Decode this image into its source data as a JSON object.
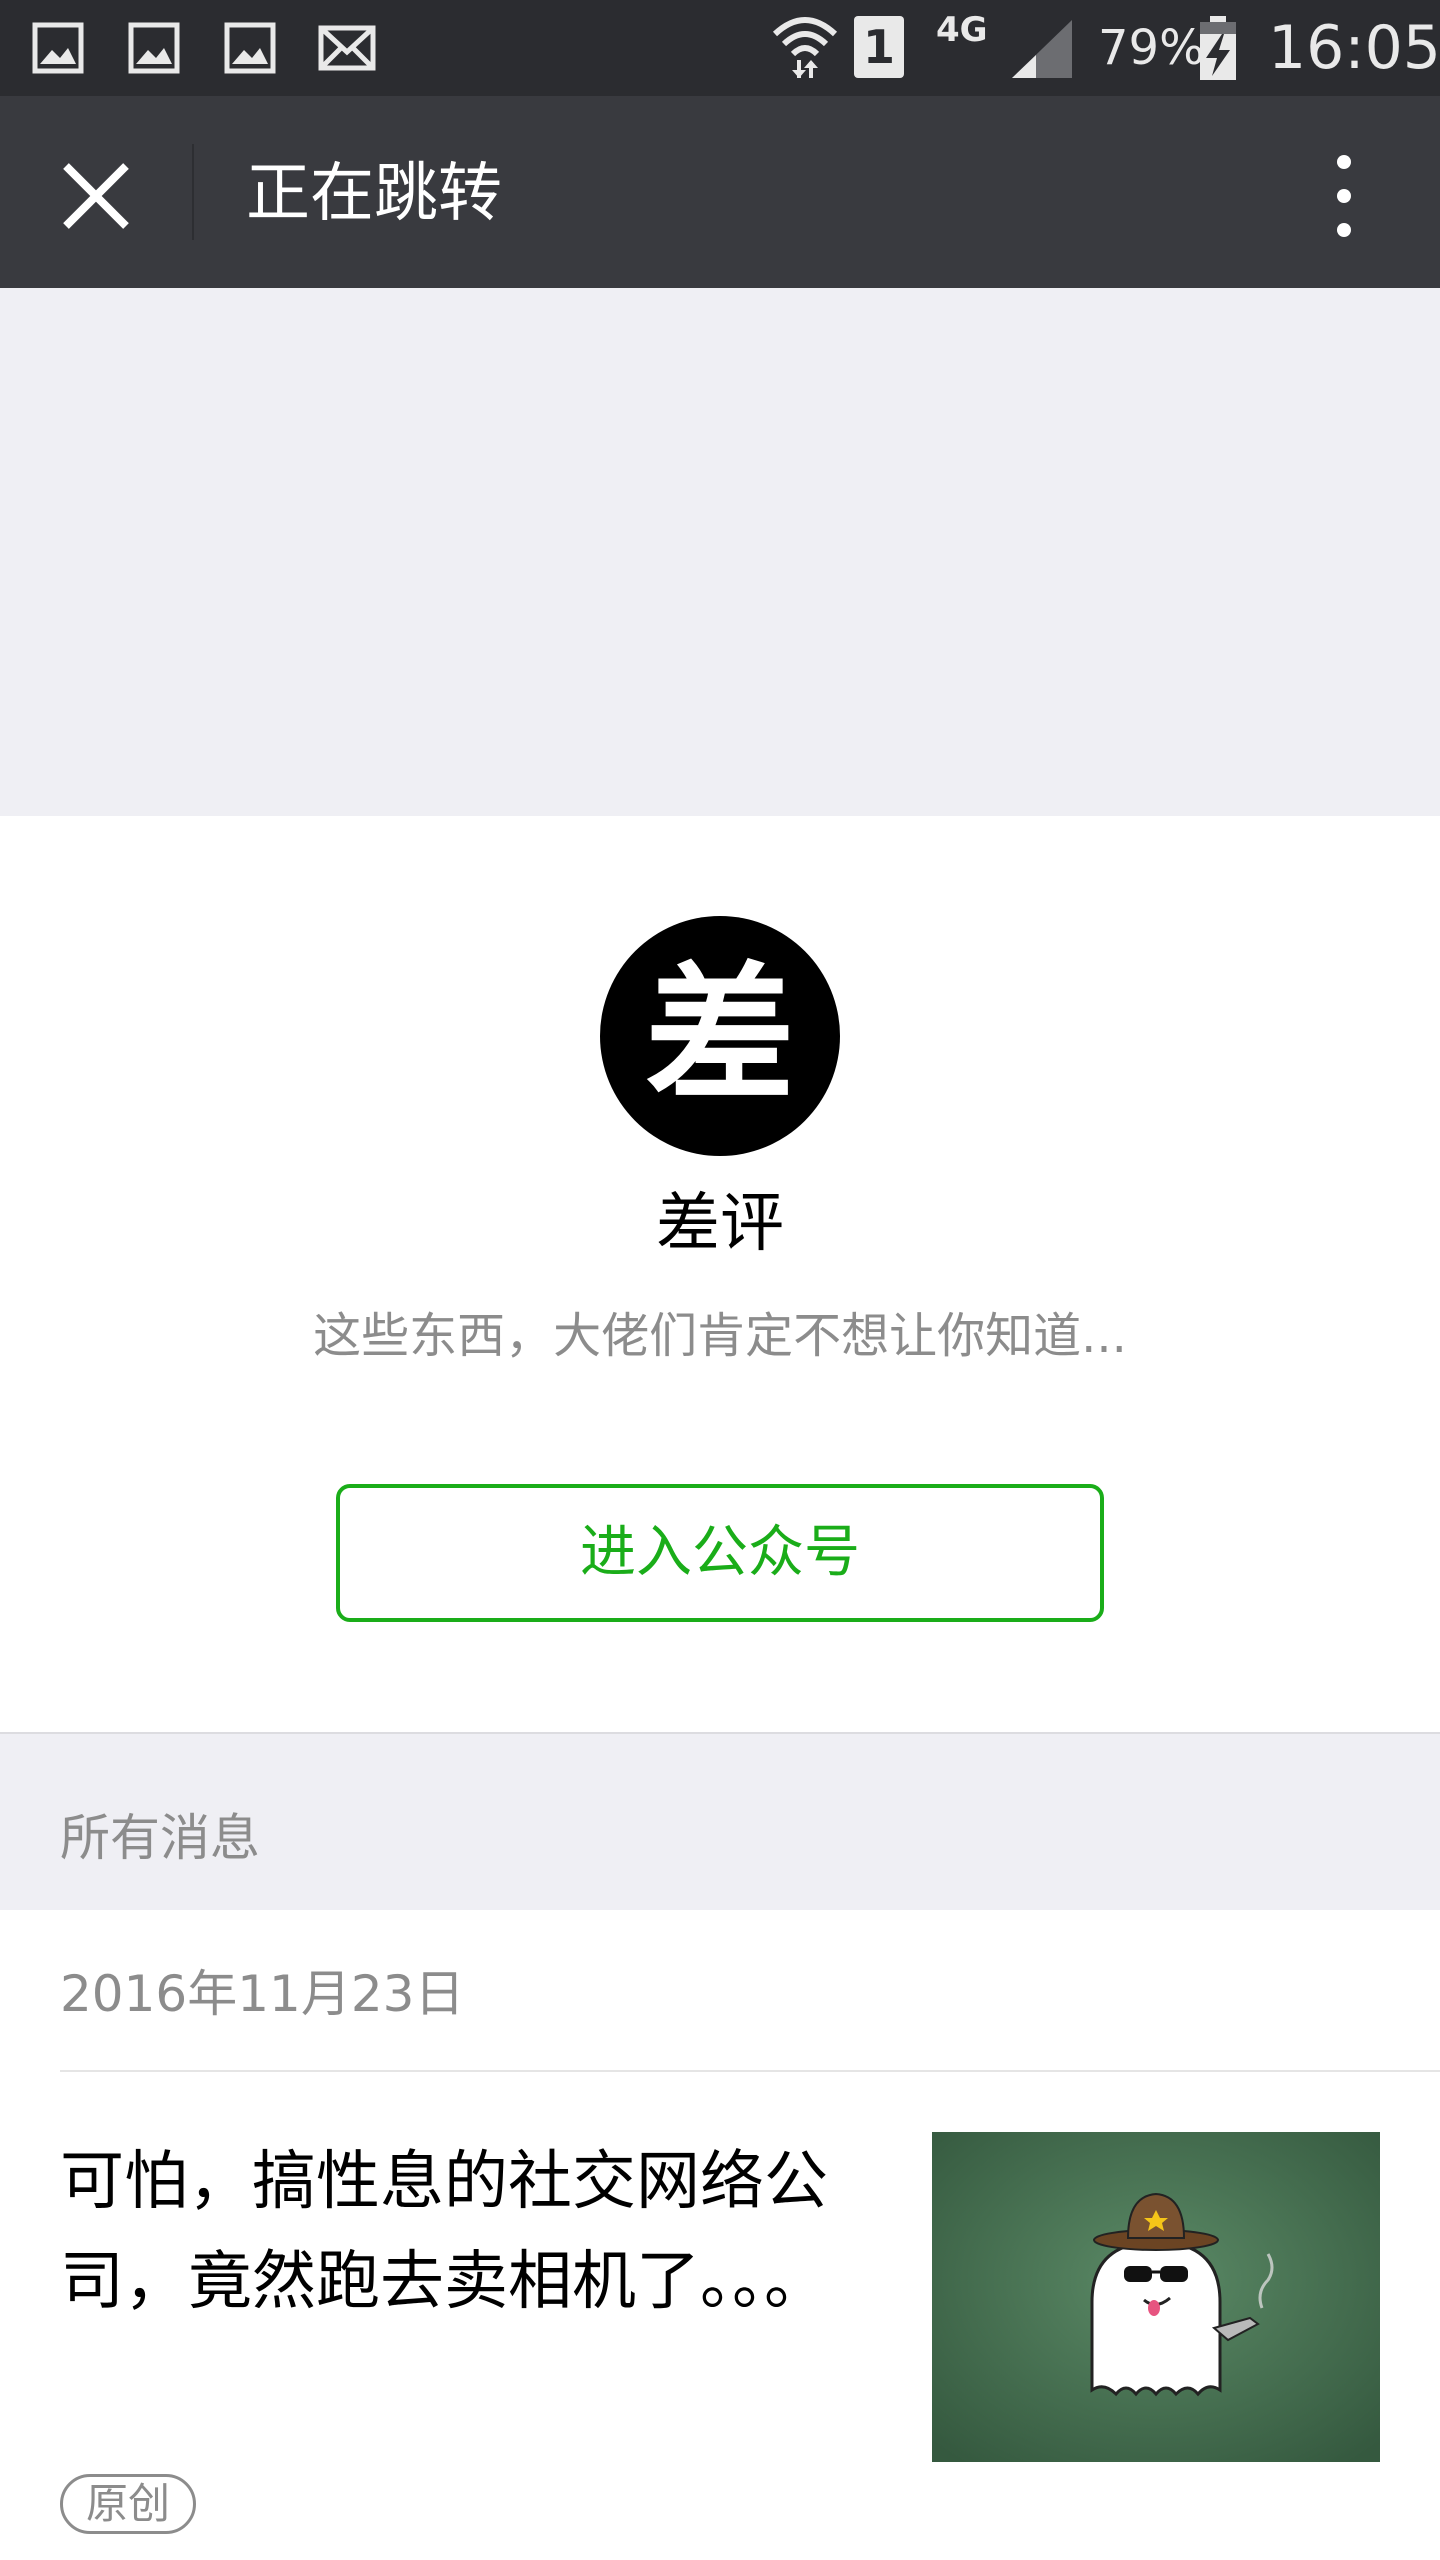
{
  "status_bar": {
    "battery_text": "79%",
    "time": "16:05",
    "network": "4G",
    "sim": "1",
    "icons": [
      "gallery-icon",
      "gallery-icon",
      "gallery-icon",
      "mail-icon",
      "wifi-icon",
      "sim-icon",
      "signal-icon",
      "battery-charging-icon"
    ]
  },
  "navbar": {
    "title": "正在跳转",
    "close_icon": "close-icon",
    "more_icon": "more-vertical-icon"
  },
  "profile": {
    "avatar_text": "差",
    "name": "差评",
    "description": "这些东西，大佬们肯定不想让你知道...",
    "enter_button": "进入公众号"
  },
  "messages": {
    "section_title": "所有消息",
    "date": "2016年11月23日",
    "article": {
      "title": "可怕，搞性息的社交网络公司，竟然跑去卖相机了。。。",
      "tag": "原创"
    }
  },
  "colors": {
    "status_bar_bg": "#2b2c30",
    "navbar_bg": "#393a3f",
    "accent_green": "#1aad19",
    "page_gray": "#efeff4"
  }
}
